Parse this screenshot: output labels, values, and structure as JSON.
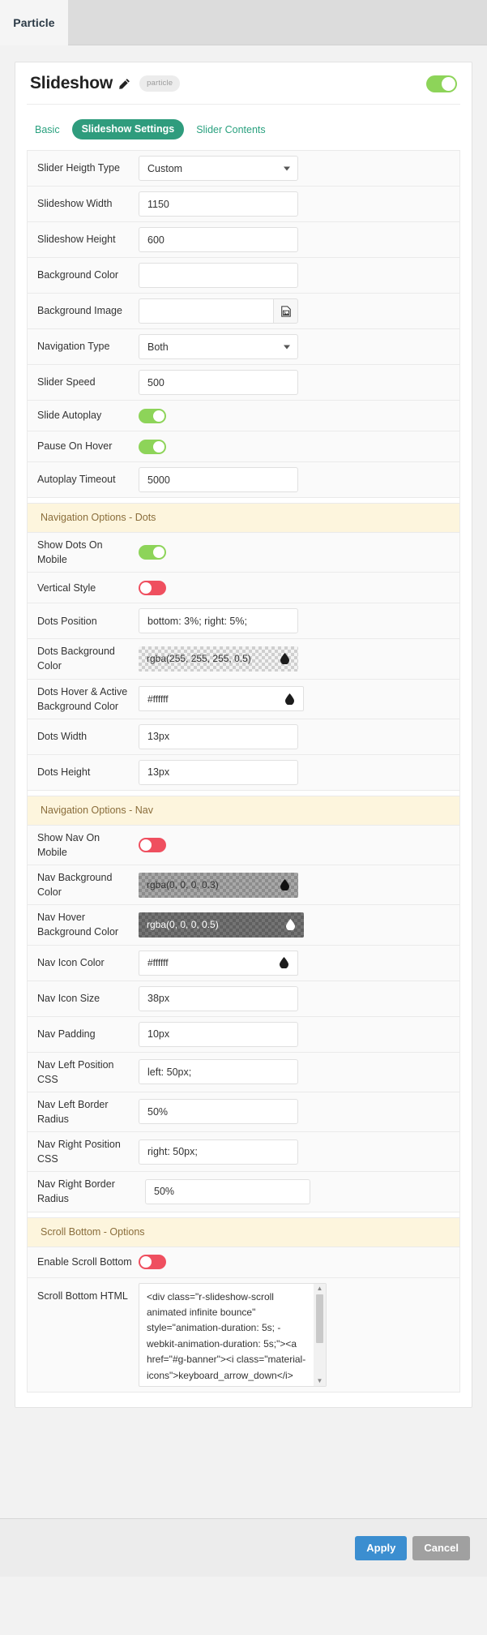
{
  "topbar": {
    "tab_label": "Particle"
  },
  "header": {
    "title": "Slideshow",
    "badge": "particle",
    "edit_icon": "pencil-icon",
    "enabled_toggle": "on"
  },
  "tabs": [
    {
      "label": "Basic",
      "active": false
    },
    {
      "label": "Slideshow Settings",
      "active": true
    },
    {
      "label": "Slider Contents",
      "active": false
    }
  ],
  "fields": {
    "slider_height_type": {
      "label": "Slider Heigth Type",
      "value": "Custom"
    },
    "slideshow_width": {
      "label": "Slideshow Width",
      "value": "1150"
    },
    "slideshow_height": {
      "label": "Slideshow Height",
      "value": "600"
    },
    "background_color": {
      "label": "Background Color",
      "value": ""
    },
    "background_image": {
      "label": "Background Image",
      "value": "",
      "button_icon": "image-picker-icon"
    },
    "navigation_type": {
      "label": "Navigation Type",
      "value": "Both"
    },
    "slider_speed": {
      "label": "Slider Speed",
      "value": "500"
    },
    "slide_autoplay": {
      "label": "Slide Autoplay",
      "state": "on"
    },
    "pause_on_hover": {
      "label": "Pause On Hover",
      "state": "on"
    },
    "autoplay_timeout": {
      "label": "Autoplay Timeout",
      "value": "5000"
    },
    "show_dots_on_mobile": {
      "label": "Show Dots On Mobile",
      "state": "on"
    },
    "vertical_style": {
      "label": "Vertical Style",
      "state": "off"
    },
    "dots_position": {
      "label": "Dots Position",
      "value": "bottom: 3%; right: 5%;"
    },
    "dots_background_color": {
      "label": "Dots Background Color",
      "value": "rgba(255, 255, 255, 0.5)"
    },
    "dots_hover_active_background_color": {
      "label": "Dots Hover & Active Background Color",
      "value": "#ffffff"
    },
    "dots_width": {
      "label": "Dots Width",
      "value": "13px"
    },
    "dots_height": {
      "label": "Dots Height",
      "value": "13px"
    },
    "show_nav_on_mobile": {
      "label": "Show Nav On Mobile",
      "state": "off"
    },
    "nav_background_color": {
      "label": "Nav Background Color",
      "value": "rgba(0, 0, 0, 0.3)"
    },
    "nav_hover_background_color": {
      "label": "Nav Hover Background Color",
      "value": "rgba(0, 0, 0, 0.5)"
    },
    "nav_icon_color": {
      "label": "Nav Icon Color",
      "value": "#ffffff"
    },
    "nav_icon_size": {
      "label": "Nav Icon Size",
      "value": "38px"
    },
    "nav_padding": {
      "label": "Nav Padding",
      "value": "10px"
    },
    "nav_left_position_css": {
      "label": "Nav Left Position CSS",
      "value": "left: 50px;"
    },
    "nav_left_border_radius": {
      "label": "Nav Left Border Radius",
      "value": "50%"
    },
    "nav_right_position_css": {
      "label": "Nav Right Position CSS",
      "value": "right: 50px;"
    },
    "nav_right_border_radius": {
      "label": "Nav Right Border Radius",
      "value": "50%"
    },
    "enable_scroll_bottom": {
      "label": "Enable Scroll Bottom",
      "state": "off"
    },
    "scroll_bottom_html": {
      "label": "Scroll Bottom HTML",
      "value": "<div class=\"r-slideshow-scroll animated infinite bounce\" style=\"animation-duration: 5s; -webkit-animation-duration: 5s;\"><a href=\"#g-banner\"><i class=\"material-icons\">keyboard_arrow_down</i></a>"
    }
  },
  "sections": {
    "dots": "Navigation Options - Dots",
    "nav": "Navigation Options - Nav",
    "scroll_bottom": "Scroll Bottom - Options"
  },
  "footer": {
    "apply_label": "Apply",
    "cancel_label": "Cancel"
  },
  "colors": {
    "accent_green": "#2f9c7d",
    "toggle_on": "#8dd459",
    "toggle_off": "#ef4f5f",
    "section_bg": "#fdf5dd",
    "section_text": "#8a6d3b",
    "apply_blue": "#3b8ed0",
    "cancel_gray": "#a0a0a0"
  }
}
